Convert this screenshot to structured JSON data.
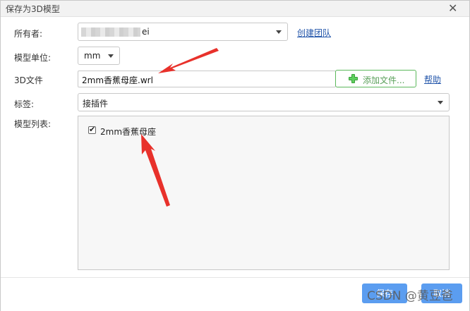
{
  "dialog": {
    "title": "保存为3D模型",
    "close_glyph": "✕"
  },
  "owner": {
    "label": "所有者:",
    "value_suffix": "ei",
    "create_team_link": "创建团队"
  },
  "unit": {
    "label": "模型单位:",
    "value": "mm"
  },
  "file": {
    "label": "3D文件",
    "value": "2mm香蕉母座.wrl",
    "add_button": "添加文件...",
    "help_link": "帮助"
  },
  "tags": {
    "label": "标签:",
    "value": "接插件"
  },
  "model_list": {
    "label": "模型列表:",
    "items": [
      {
        "label": "2mm香蕉母座",
        "checked": true
      }
    ]
  },
  "footer": {
    "save_label": "保存",
    "cancel_label": "取消"
  },
  "watermark": "CSDN @黄豆爸",
  "colors": {
    "accent": "#5b9df0",
    "link": "#2255aa",
    "add_green": "#5cb85c",
    "annotation_red": "#e8312b"
  }
}
